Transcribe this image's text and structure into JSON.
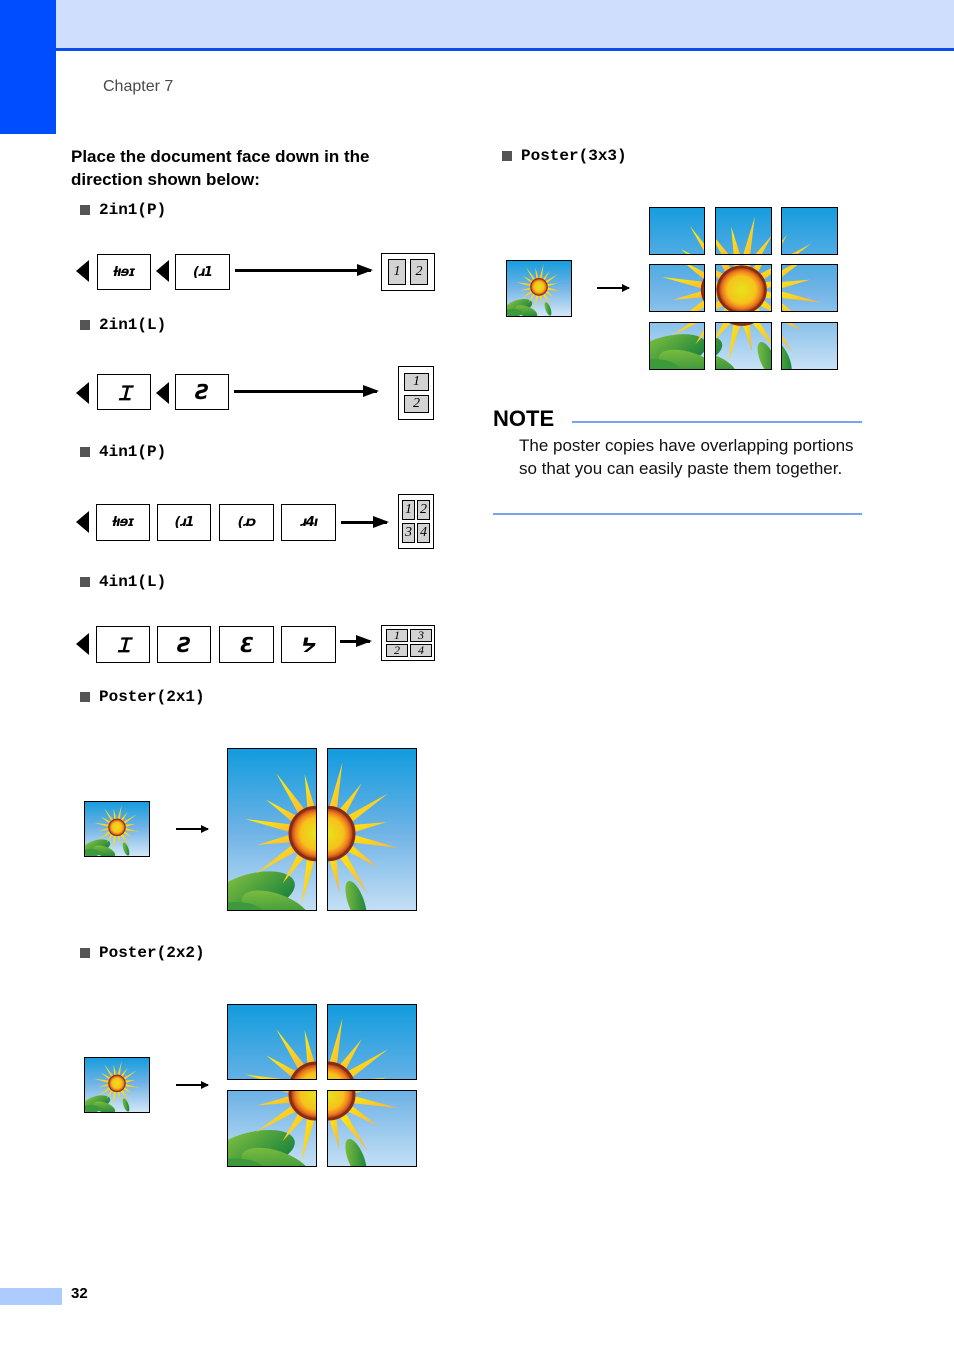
{
  "header": {
    "chapter_label": "Chapter 7",
    "colors": {
      "band": "#cfdefc",
      "accent": "#0b4ef0",
      "side_tab": "#004cff"
    }
  },
  "intro": "Place the document face down in the direction shown below:",
  "sections": {
    "two_in_one_p": {
      "label": "2in1(P)",
      "input_pages": [
        "1",
        "2"
      ],
      "output_cells": [
        "1",
        "2"
      ]
    },
    "two_in_one_l": {
      "label": "2in1(L)",
      "input_pages": [
        "1",
        "2"
      ],
      "output_cells": [
        "1",
        "2"
      ]
    },
    "four_in_one_p": {
      "label": "4in1(P)",
      "input_pages": [
        "1",
        "2",
        "3",
        "4"
      ],
      "output_cells": [
        "1",
        "2",
        "3",
        "4"
      ]
    },
    "four_in_one_l": {
      "label": "4in1(L)",
      "input_pages": [
        "1",
        "2",
        "3",
        "4"
      ],
      "output_cells": [
        "1",
        "3",
        "2",
        "4"
      ]
    },
    "poster_2x1": {
      "label": "Poster(2x1)",
      "cols": 2,
      "rows": 1
    },
    "poster_2x2": {
      "label": "Poster(2x2)",
      "cols": 2,
      "rows": 2
    },
    "poster_3x3": {
      "label": "Poster(3x3)",
      "cols": 3,
      "rows": 3
    }
  },
  "note": {
    "title": "NOTE",
    "text": "The poster copies have overlapping portions so that you can easily paste them together.",
    "rule_color": "#7ba2ef"
  },
  "footer": {
    "page_number": "32"
  }
}
